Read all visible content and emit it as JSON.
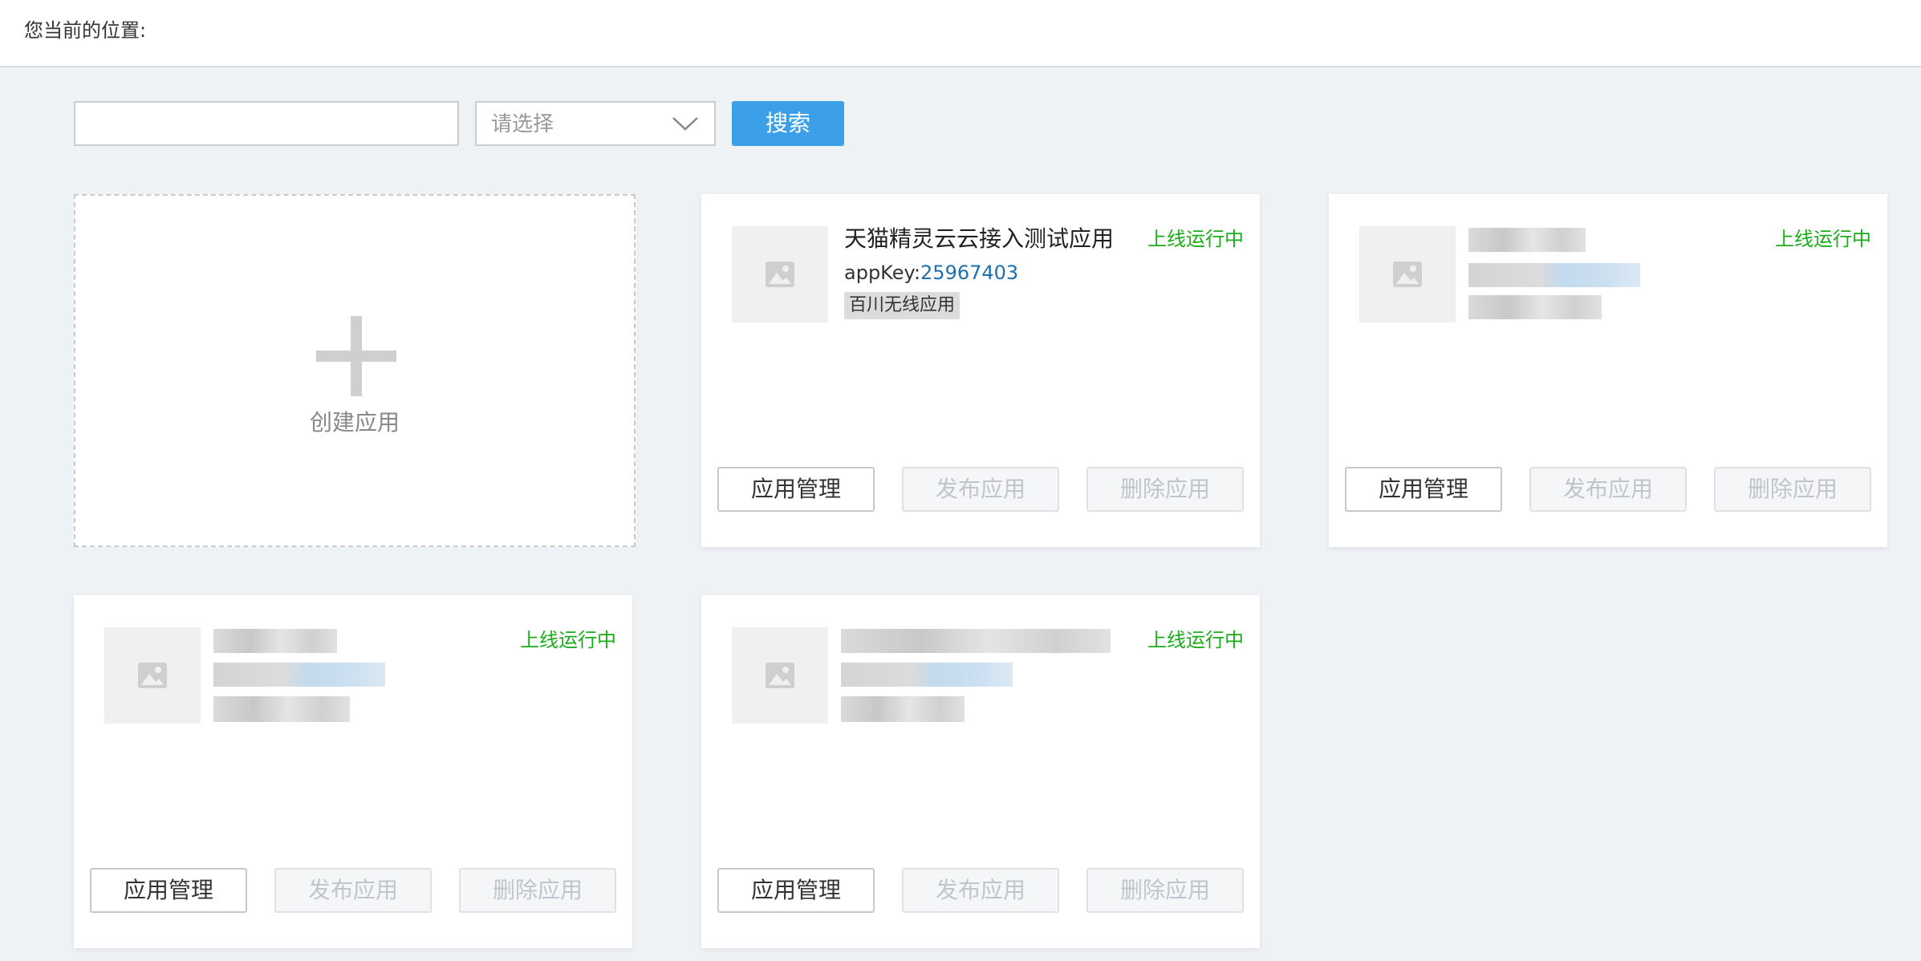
{
  "header": {
    "breadcrumb_label": "您当前的位置:"
  },
  "search": {
    "input_value": "",
    "select_placeholder": "请选择",
    "search_label": "搜索"
  },
  "create_card": {
    "label": "创建应用"
  },
  "apps": [
    {
      "name": "天猫精灵云云接入测试应用",
      "app_key_label": "appKey:",
      "app_key_value": "25967403",
      "tag": "百川无线应用",
      "status": "上线运行中",
      "manage_label": "应用管理",
      "publish_label": "发布应用",
      "delete_label": "删除应用"
    },
    {
      "status": "上线运行中",
      "manage_label": "应用管理",
      "publish_label": "发布应用",
      "delete_label": "删除应用"
    },
    {
      "status": "上线运行中",
      "manage_label": "应用管理",
      "publish_label": "发布应用",
      "delete_label": "删除应用"
    },
    {
      "status": "上线运行中",
      "manage_label": "应用管理",
      "publish_label": "发布应用",
      "delete_label": "删除应用"
    }
  ],
  "colors": {
    "status_green": "#1aad19",
    "primary_blue": "#3ba0e8",
    "app_key_blue": "#1f6eb0"
  },
  "icons": {
    "thumbnail": "image-placeholder-icon",
    "dropdown": "chevron-down-icon",
    "create": "plus-icon"
  }
}
